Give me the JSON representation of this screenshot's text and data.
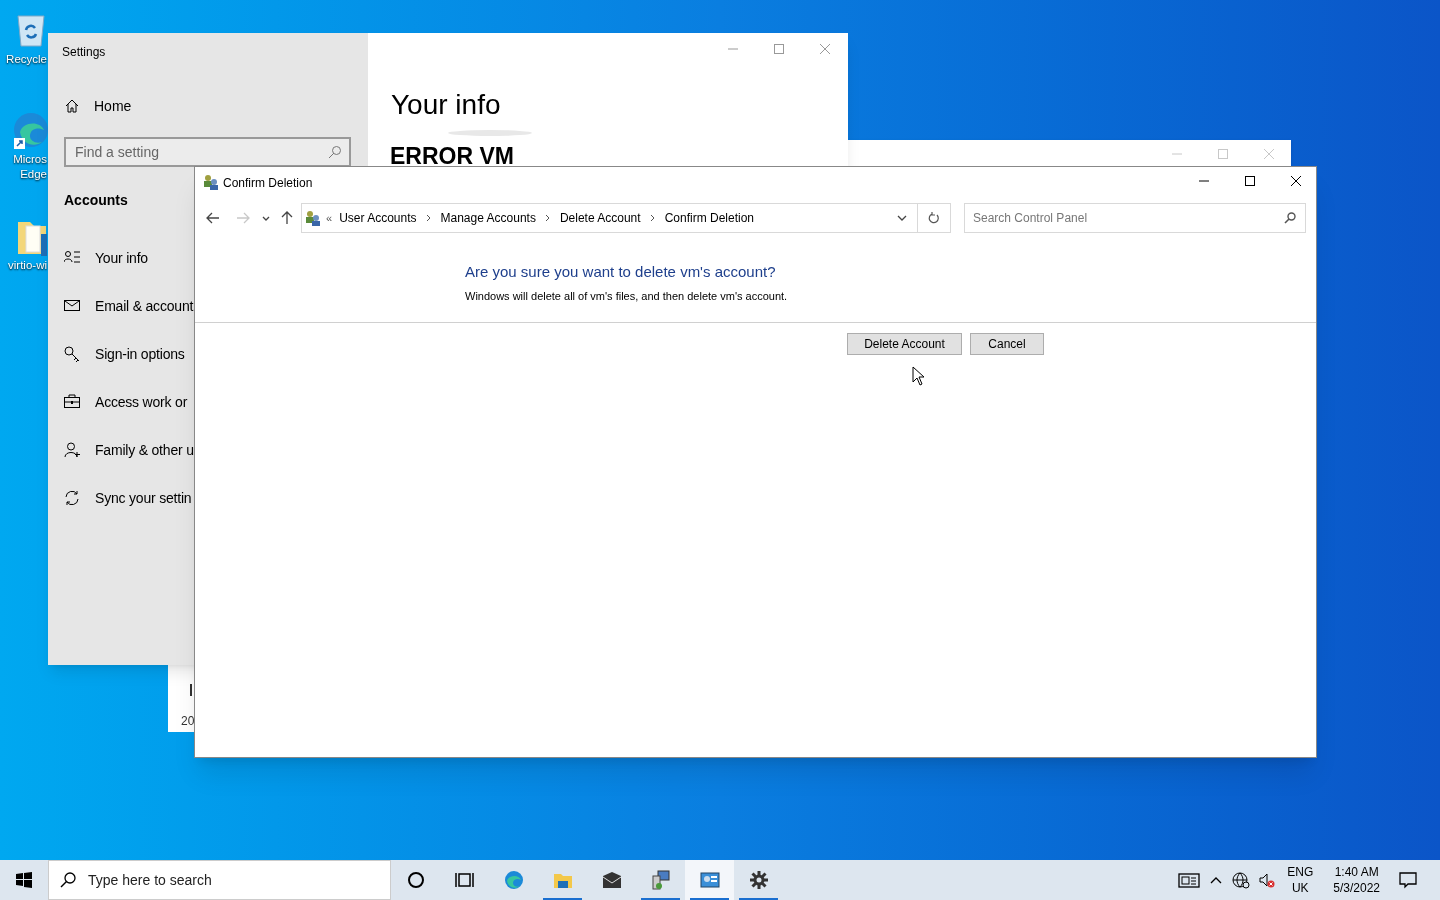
{
  "desktop_icons": [
    {
      "lines": [
        "Recycle"
      ]
    },
    {
      "lines": [
        "Micros",
        "Edge"
      ]
    },
    {
      "lines": [
        "virtio-wi"
      ]
    }
  ],
  "settings_window": {
    "title": "Settings",
    "home": "Home",
    "search": {
      "placeholder": "Find a setting"
    },
    "section": "Accounts",
    "page_title": "Your info",
    "account_name": "ERROR VM",
    "items": [
      {
        "label": "Your info"
      },
      {
        "label": "Email & account"
      },
      {
        "label": "Sign-in options"
      },
      {
        "label": "Access work or"
      },
      {
        "label": "Family & other u"
      },
      {
        "label": "Sync your settin"
      }
    ]
  },
  "back_window": {
    "text": "20"
  },
  "dialog": {
    "title": "Confirm Deletion",
    "back_disabled": false,
    "forward_disabled": true,
    "overflow": "«",
    "breadcrumb": [
      "User Accounts",
      "Manage Accounts",
      "Delete Account",
      "Confirm Deletion"
    ],
    "search": {
      "placeholder": "Search Control Panel"
    },
    "heading": "Are you sure you want to delete vm's account?",
    "message": "Windows will delete all of vm's files, and then delete vm's account.",
    "buttons": [
      {
        "label": "Delete Account"
      },
      {
        "label": "Cancel"
      }
    ]
  },
  "taskbar": {
    "search": {
      "placeholder": "Type here to search"
    },
    "apps": [
      {
        "running": false,
        "selected": false
      },
      {
        "running": false,
        "selected": false
      },
      {
        "running": false,
        "selected": false
      },
      {
        "running": true,
        "selected": false
      },
      {
        "running": false,
        "selected": false
      },
      {
        "running": true,
        "selected": false
      },
      {
        "running": true,
        "selected": true
      },
      {
        "running": true,
        "selected": false
      }
    ],
    "language": [
      "ENG",
      "UK"
    ],
    "time": "1:40 AM",
    "date": "5/3/2022"
  }
}
